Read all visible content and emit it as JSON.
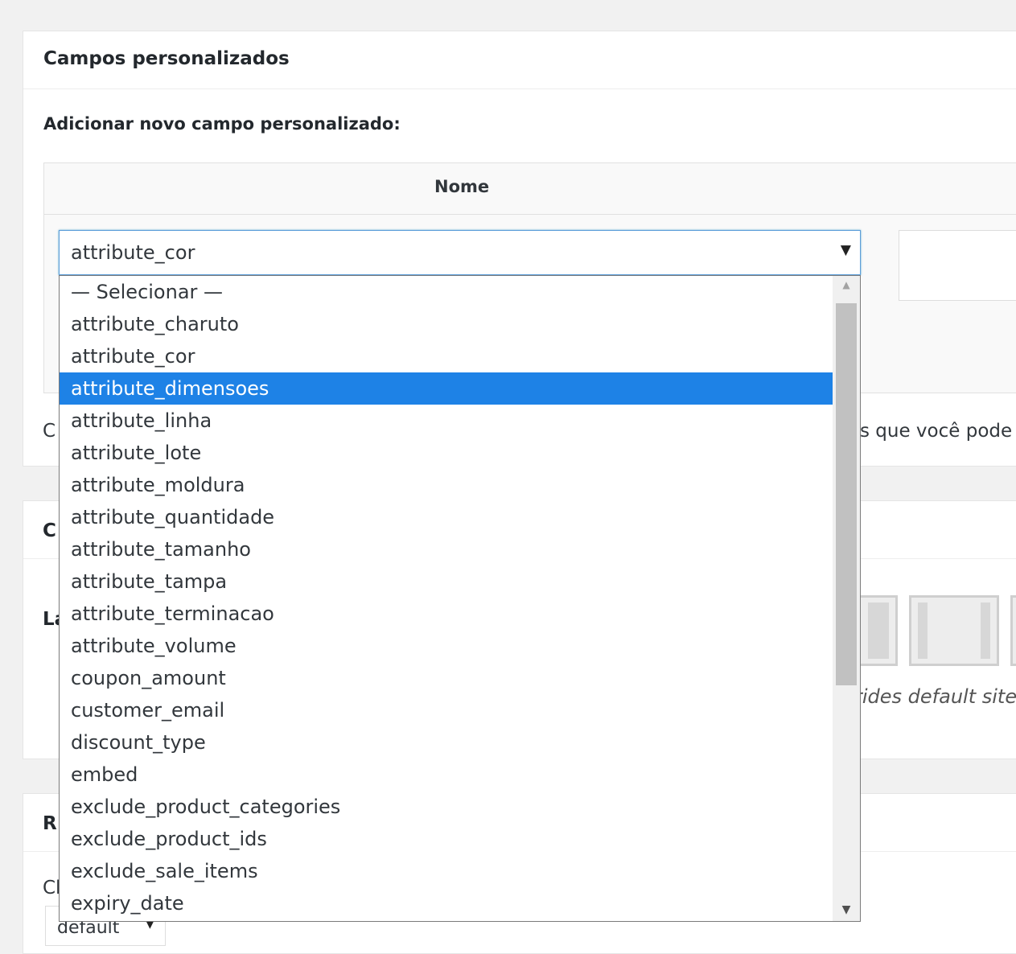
{
  "panel": {
    "title": "Campos personalizados",
    "subtitle": "Adicionar novo campo personalizado:",
    "column_name_header": "Nome",
    "help_text_fragment": "s que você pode"
  },
  "select": {
    "current_value": "attribute_cor",
    "arrow": "▼",
    "options": [
      "— Selecionar —",
      "attribute_charuto",
      "attribute_cor",
      "attribute_dimensoes",
      "attribute_linha",
      "attribute_lote",
      "attribute_moldura",
      "attribute_quantidade",
      "attribute_tamanho",
      "attribute_tampa",
      "attribute_terminacao",
      "attribute_volume",
      "coupon_amount",
      "customer_email",
      "discount_type",
      "embed",
      "exclude_product_categories",
      "exclude_product_ids",
      "exclude_sale_items",
      "expiry_date"
    ],
    "highlighted_option": "attribute_dimensoes"
  },
  "layout_panel": {
    "help_text_fragment": "rides default site"
  },
  "bottom_panel": {
    "select_value": "default",
    "arrow": "▼"
  },
  "hidden_fragments": {
    "a": "C",
    "b": "C",
    "c": "La",
    "d": "R",
    "e": "Cl"
  },
  "colors": {
    "highlight": "#1e82e6",
    "focus_border": "#5b9dd9"
  },
  "icons": {
    "scroll_up": "triangle-up-icon",
    "scroll_down": "triangle-down-icon",
    "select_arrow": "chevron-down-icon"
  }
}
